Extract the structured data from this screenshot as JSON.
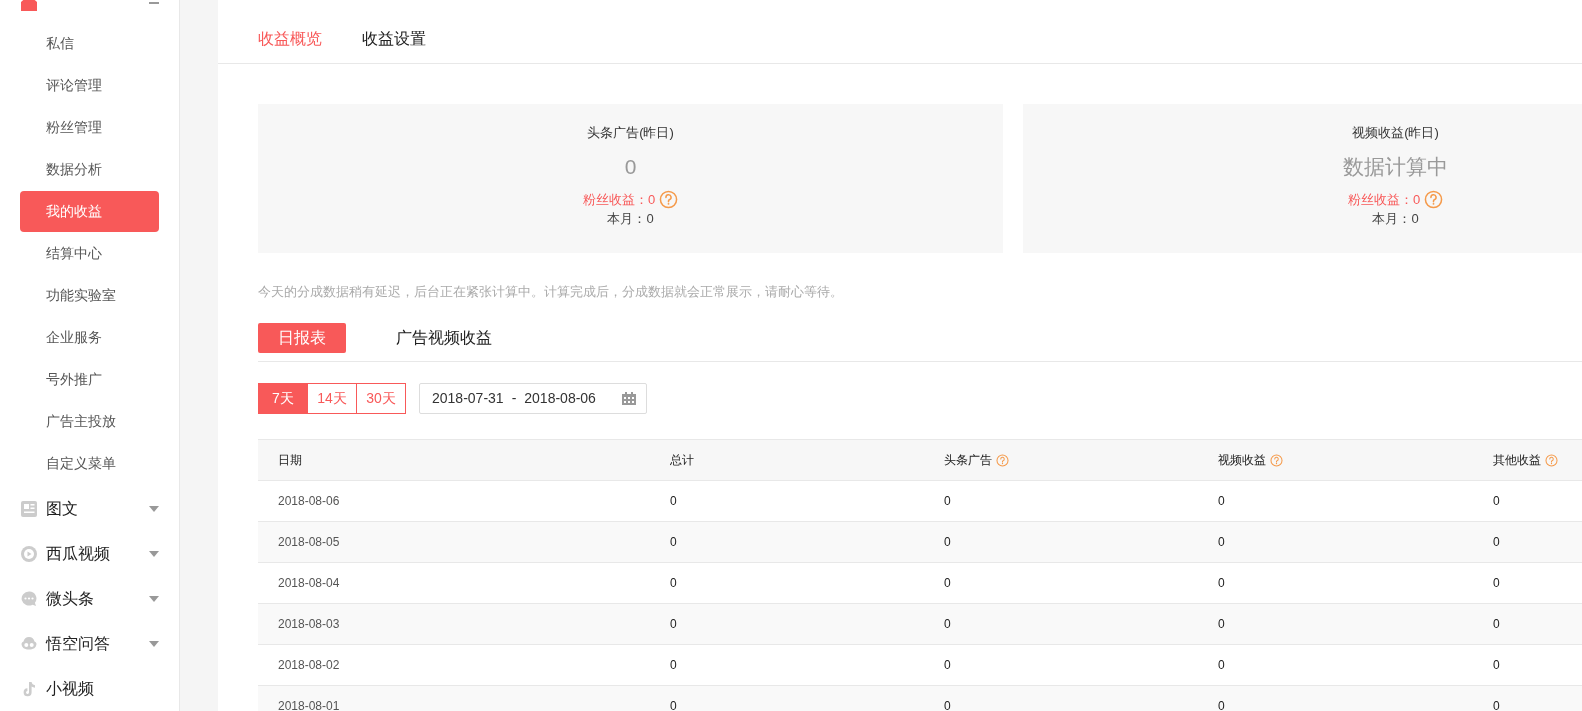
{
  "sidebar": {
    "section": {
      "expanded": true
    },
    "items": [
      {
        "label": "私信",
        "selected": false
      },
      {
        "label": "评论管理",
        "selected": false
      },
      {
        "label": "粉丝管理",
        "selected": false
      },
      {
        "label": "数据分析",
        "selected": false
      },
      {
        "label": "我的收益",
        "selected": true
      },
      {
        "label": "结算中心",
        "selected": false
      },
      {
        "label": "功能实验室",
        "selected": false
      },
      {
        "label": "企业服务",
        "selected": false
      },
      {
        "label": "号外推广",
        "selected": false
      },
      {
        "label": "广告主投放",
        "selected": false
      },
      {
        "label": "自定义菜单",
        "selected": false
      }
    ],
    "groups": [
      {
        "label": "图文",
        "kind": "article",
        "expandable": true
      },
      {
        "label": "西瓜视频",
        "kind": "video",
        "expandable": true
      },
      {
        "label": "微头条",
        "kind": "chat",
        "expandable": true
      },
      {
        "label": "悟空问答",
        "kind": "qa",
        "expandable": true
      },
      {
        "label": "小视频",
        "kind": "note",
        "expandable": false
      }
    ]
  },
  "tabs": [
    {
      "label": "收益概览",
      "selected": true
    },
    {
      "label": "收益设置",
      "selected": false
    }
  ],
  "cards": [
    {
      "title": "头条广告(昨日)",
      "value": "0",
      "fans": "粉丝收益：0",
      "month": "本月：0"
    },
    {
      "title": "视频收益(昨日)",
      "value": "数据计算中",
      "fans": "粉丝收益：0",
      "month": "本月：0"
    }
  ],
  "notice": "今天的分成数据稍有延迟，后台正在紧张计算中。计算完成后，分成数据就会正常展示，请耐心等待。",
  "report_tabs": [
    {
      "label": "日报表",
      "selected": true
    },
    {
      "label": "广告视频收益",
      "selected": false
    }
  ],
  "ranges": [
    {
      "label": "7天",
      "selected": true
    },
    {
      "label": "14天",
      "selected": false
    },
    {
      "label": "30天",
      "selected": false
    }
  ],
  "date_range": {
    "start": "2018-07-31",
    "separator": "-",
    "end": "2018-08-06"
  },
  "table": {
    "columns": [
      {
        "label": "日期",
        "help": false
      },
      {
        "label": "总计",
        "help": false
      },
      {
        "label": "头条广告",
        "help": true
      },
      {
        "label": "视频收益",
        "help": true
      },
      {
        "label": "其他收益",
        "help": true
      }
    ],
    "rows": [
      [
        "2018-08-06",
        "0",
        "0",
        "0",
        "0"
      ],
      [
        "2018-08-05",
        "0",
        "0",
        "0",
        "0"
      ],
      [
        "2018-08-04",
        "0",
        "0",
        "0",
        "0"
      ],
      [
        "2018-08-03",
        "0",
        "0",
        "0",
        "0"
      ],
      [
        "2018-08-02",
        "0",
        "0",
        "0",
        "0"
      ],
      [
        "2018-08-01",
        "0",
        "0",
        "0",
        "0"
      ]
    ]
  }
}
